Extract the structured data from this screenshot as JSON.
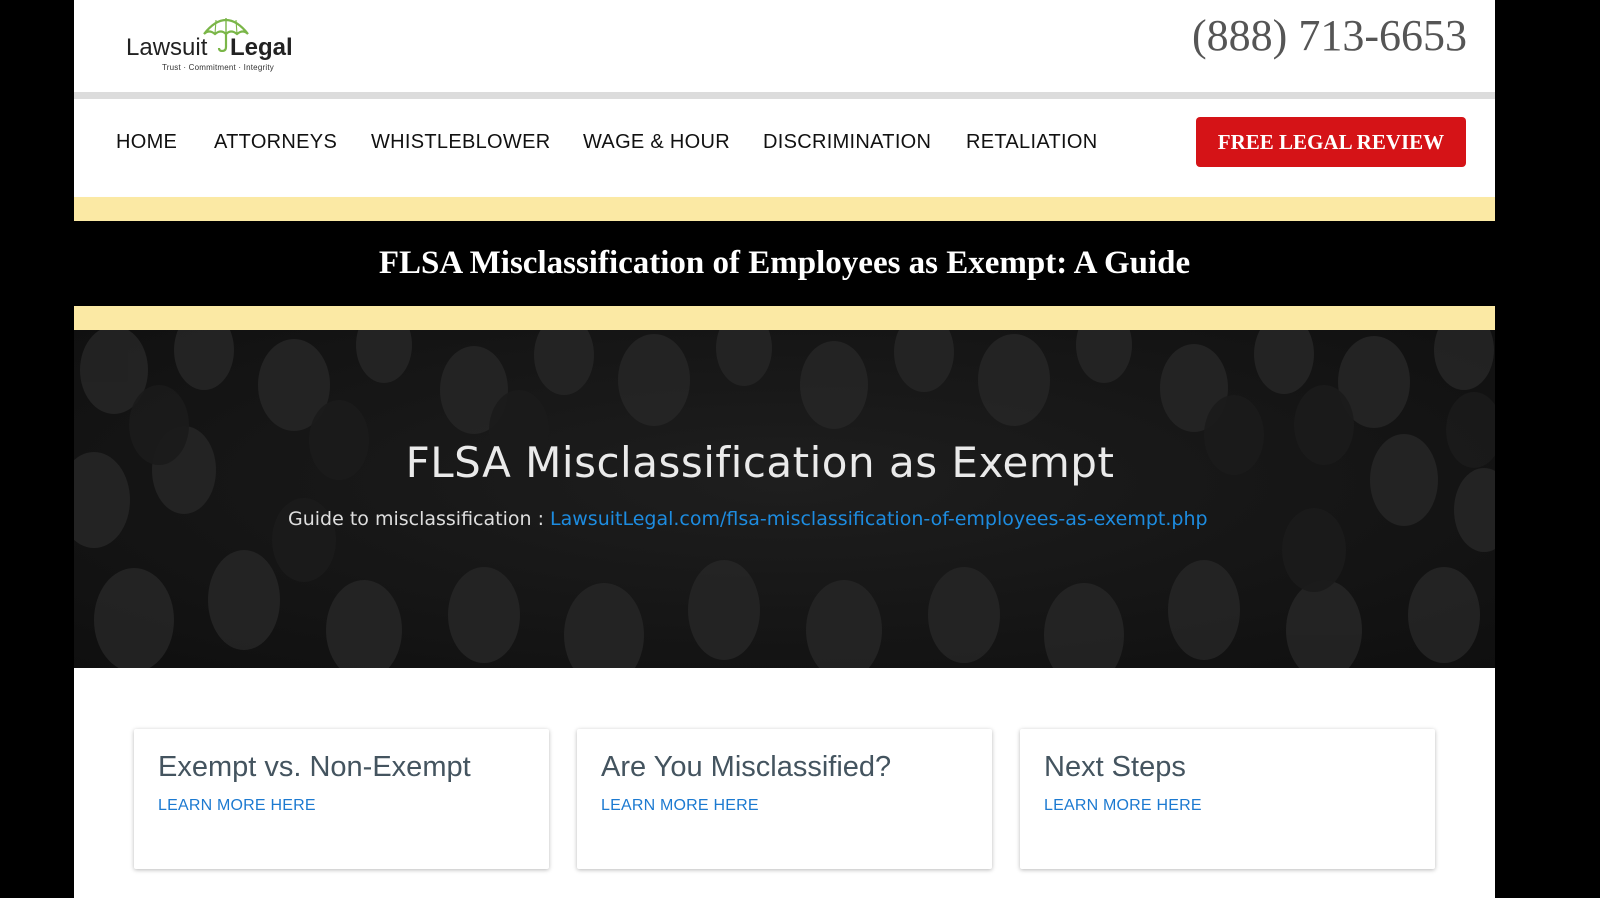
{
  "header": {
    "logo": {
      "word1": "Lawsuit",
      "word2": "Legal",
      "tagline": "Trust · Commitment · Integrity"
    },
    "phone": "(888) 713-6653"
  },
  "nav": {
    "items": [
      {
        "label": "HOME"
      },
      {
        "label": "ATTORNEYS"
      },
      {
        "label": "WHISTLEBLOWER"
      },
      {
        "label": "WAGE & HOUR"
      },
      {
        "label": "DISCRIMINATION"
      },
      {
        "label": "RETALIATION"
      }
    ],
    "cta_label": "FREE LEGAL REVIEW"
  },
  "page_title": "FLSA Misclassification of Employees as Exempt: A Guide",
  "hero": {
    "heading": "FLSA Misclassification as Exempt",
    "sub_label": "Guide to misclassification :",
    "link_text": "LawsuitLegal.com/flsa-misclassification-of-employees-as-exempt.php"
  },
  "cards": [
    {
      "title": "Exempt vs. Non-Exempt",
      "link": "LEARN MORE HERE"
    },
    {
      "title": "Are You Misclassified?",
      "link": "LEARN MORE HERE"
    },
    {
      "title": "Next Steps",
      "link": "LEARN MORE HERE"
    }
  ],
  "colors": {
    "brand_red": "#d51317",
    "ribbon_gold": "#fbe9a4",
    "link_blue": "#1c7ad1",
    "umbrella_green": "#7ab648"
  }
}
